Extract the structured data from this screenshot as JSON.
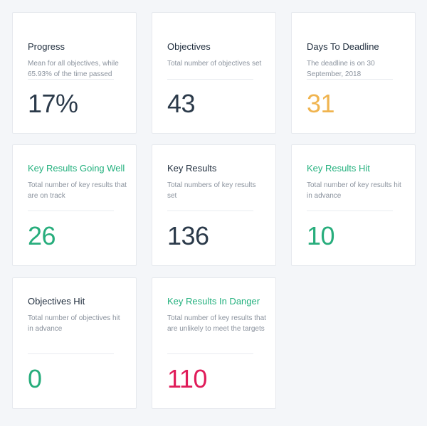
{
  "cards": [
    {
      "title": "Progress",
      "description": "Mean for all objectives, while 65.93% of the time passed",
      "value": "17%"
    },
    {
      "title": "Objectives",
      "description": "Total number of objectives set",
      "value": "43"
    },
    {
      "title": "Days To Deadline",
      "description": "The deadline is on 30 September, 2018",
      "value": "31"
    },
    {
      "title": "Key Results Going Well",
      "description": "Total number of key results that are on track",
      "value": "26"
    },
    {
      "title": "Key Results",
      "description": "Total numbers of key results set",
      "value": "136"
    },
    {
      "title": "Key Results Hit",
      "description": "Total number of key results hit in advance",
      "value": "10"
    },
    {
      "title": "Objectives Hit",
      "description": "Total number of objectives hit in advance",
      "value": "0"
    },
    {
      "title": "Key Results In Danger",
      "description": "Total number of key results that are unlikely to meet the targets",
      "value": "110"
    }
  ],
  "colors": {
    "background": "#f4f6f9",
    "card": "#ffffff",
    "title_default": "#1f2d3d",
    "title_green": "#22b07d",
    "value_default": "#2b3a4a",
    "value_orange": "#f0b44f",
    "value_green": "#27ad7c",
    "value_red": "#e01c5a"
  }
}
